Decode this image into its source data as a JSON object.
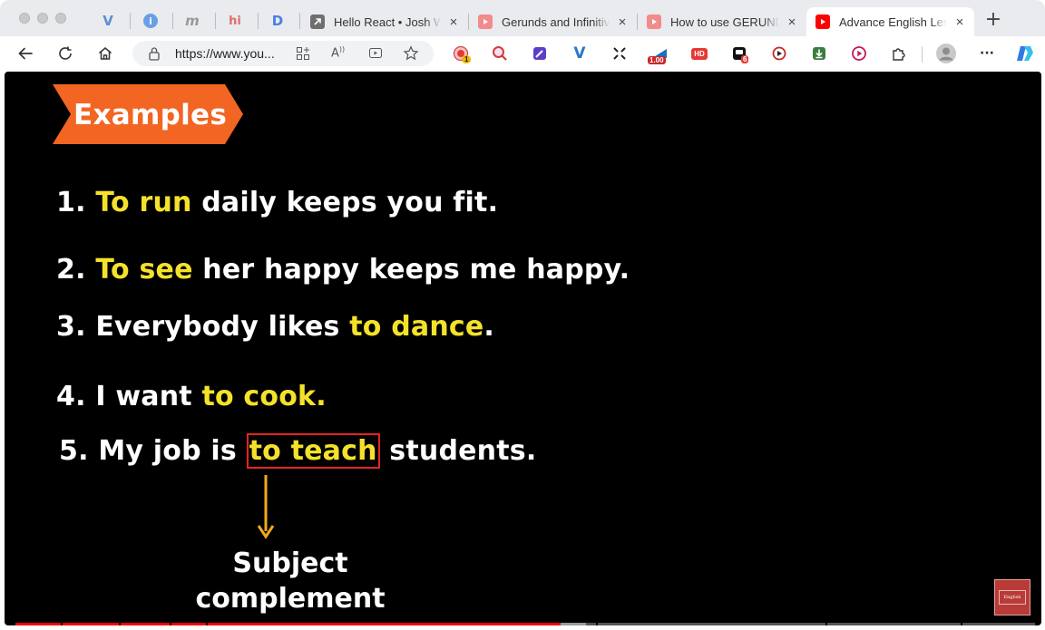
{
  "window": {
    "title": "Advance English Lesson"
  },
  "tabs": {
    "pinned": [
      {
        "name": "pinned-tab-v",
        "glyph": "V",
        "color": "#5b8fd6"
      },
      {
        "name": "pinned-tab-info",
        "glyph": "i",
        "color": "#5b8fd6"
      },
      {
        "name": "pinned-tab-m",
        "glyph": "m",
        "color": "#999999"
      },
      {
        "name": "pinned-tab-hi",
        "glyph": "hi",
        "color": "#e06c6c"
      },
      {
        "name": "pinned-tab-d",
        "glyph": "D",
        "color": "#4a7fe0"
      }
    ],
    "items": [
      {
        "title": "Hello React • Josh W",
        "icon": "arrow-square-icon",
        "active": false
      },
      {
        "title": "Gerunds and Infinitive",
        "icon": "youtube-icon",
        "active": false
      },
      {
        "title": "How to use GERUNDS",
        "icon": "youtube-icon",
        "active": false
      },
      {
        "title": "Advance English Lesson",
        "icon": "youtube-icon",
        "active": true
      }
    ],
    "close_glyph": "×",
    "new_tab_glyph": "+"
  },
  "toolbar": {
    "url": "https://www.you...",
    "extensions": [
      {
        "name": "record-extension-icon",
        "badge": "1"
      },
      {
        "name": "zoom-search-extension-icon"
      },
      {
        "name": "pen-extension-icon"
      },
      {
        "name": "v-extension-icon"
      },
      {
        "name": "sparkle-extension-icon"
      },
      {
        "name": "speed-extension-icon",
        "badge": "1.00"
      },
      {
        "name": "hd-extension-icon",
        "label": "HD"
      },
      {
        "name": "stack-extension-icon",
        "badge": "6"
      },
      {
        "name": "camera-extension-icon"
      },
      {
        "name": "download-extension-icon"
      },
      {
        "name": "play-extension-icon"
      },
      {
        "name": "puzzle-extension-icon"
      }
    ],
    "more_glyph": "···"
  },
  "video": {
    "banner": "Examples",
    "examples": [
      {
        "num": "1.",
        "parts": [
          {
            "t": "To run",
            "hl": true
          },
          {
            "t": " daily keeps you fit.",
            "hl": false
          }
        ]
      },
      {
        "num": "2.",
        "parts": [
          {
            "t": "To see",
            "hl": true
          },
          {
            "t": " her happy keeps me happy.",
            "hl": false
          }
        ]
      },
      {
        "num": "3.",
        "parts": [
          {
            "t": "Everybody likes ",
            "hl": false
          },
          {
            "t": "to dance",
            "hl": true
          },
          {
            "t": ".",
            "hl": false
          }
        ]
      },
      {
        "num": "4.",
        "parts": [
          {
            "t": "I want ",
            "hl": false
          },
          {
            "t": "to cook.",
            "hl": true
          }
        ]
      },
      {
        "num": "5.",
        "parts": [
          {
            "t": "My job is ",
            "hl": false
          },
          {
            "t": "to teach",
            "hl": true,
            "boxed": true
          },
          {
            "t": " students.",
            "hl": false
          }
        ]
      }
    ],
    "annotation": [
      "Subject",
      "complement"
    ],
    "watermark": "English",
    "progress": 0.535,
    "buffered": 0.56
  },
  "colors": {
    "highlight": "#f4e22a",
    "banner": "#f26522",
    "box": "#e52421",
    "arrow": "#f2a81d",
    "progress": "#ff0000"
  }
}
